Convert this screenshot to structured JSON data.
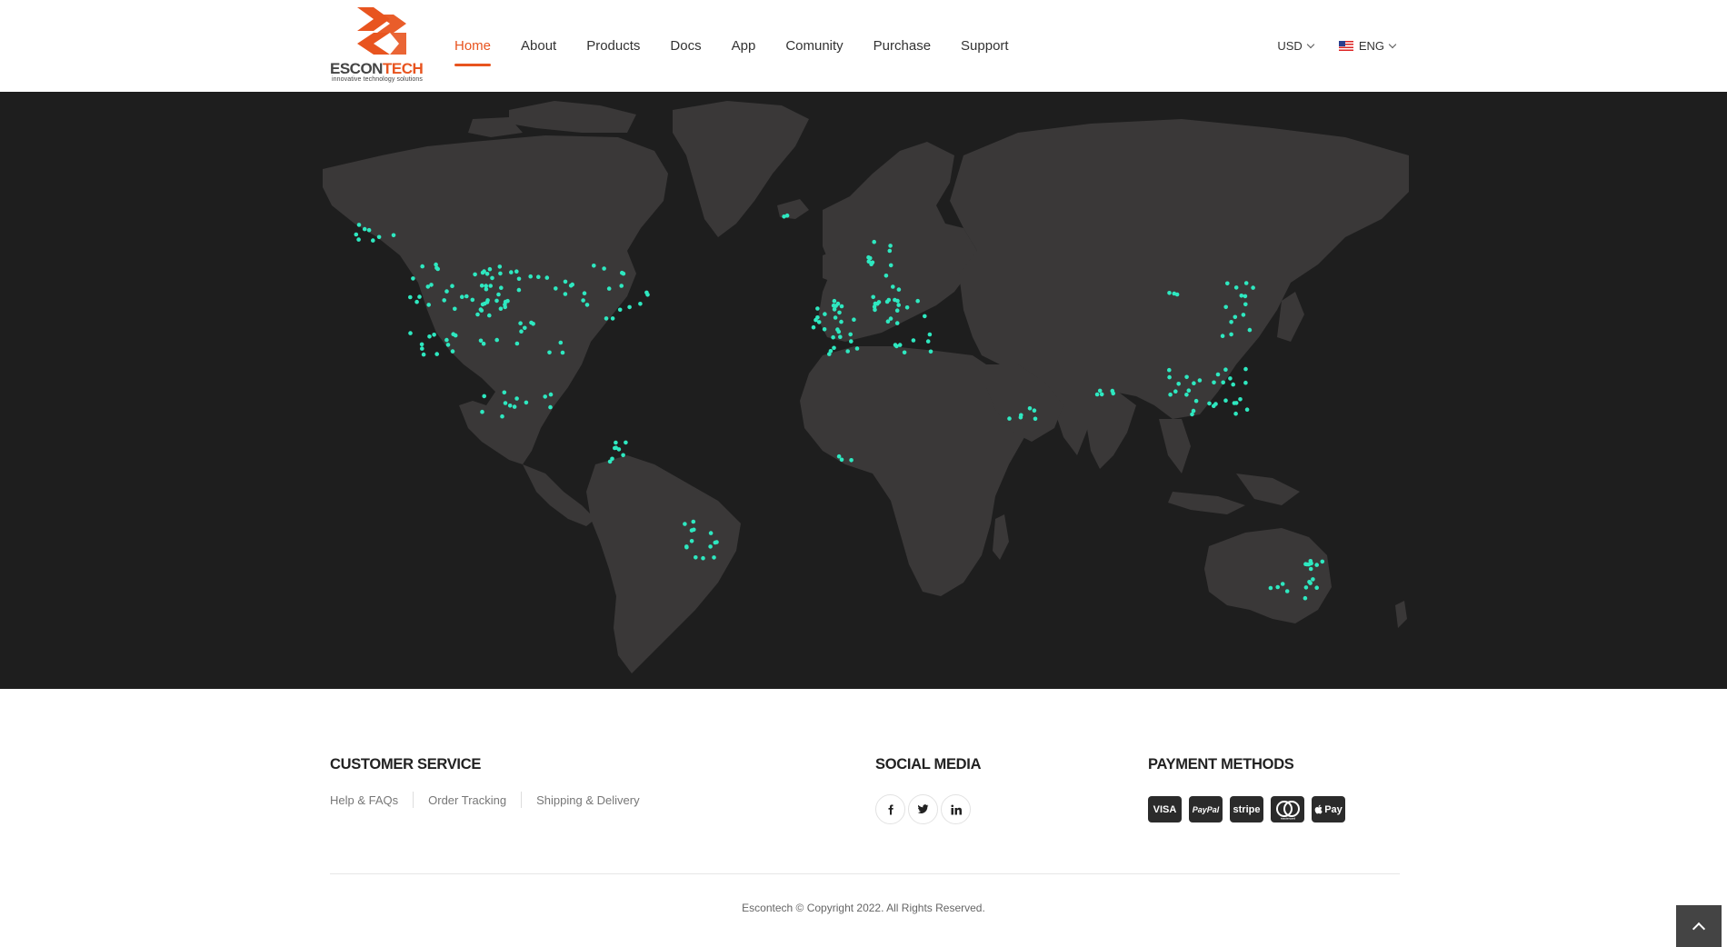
{
  "brand": {
    "name_part1": "ESCON",
    "name_part2": "TECH",
    "tagline": "innovative technology solutions",
    "accent_color": "#e8541f"
  },
  "nav": {
    "items": [
      {
        "label": "Home",
        "active": true
      },
      {
        "label": "About"
      },
      {
        "label": "Products"
      },
      {
        "label": "Docs"
      },
      {
        "label": "App"
      },
      {
        "label": "Comunity"
      },
      {
        "label": "Purchase"
      },
      {
        "label": "Support"
      }
    ]
  },
  "header_right": {
    "currency": "USD",
    "language": "ENG"
  },
  "map": {
    "background_color": "#1e1e1e",
    "land_color": "#3a3838",
    "dot_color": "#2ee8c0"
  },
  "footer": {
    "customer_service": {
      "title": "CUSTOMER SERVICE",
      "links": [
        "Help & FAQs",
        "Order Tracking",
        "Shipping & Delivery"
      ]
    },
    "social_media": {
      "title": "SOCIAL MEDIA",
      "icons": [
        "facebook-icon",
        "twitter-icon",
        "linkedin-icon"
      ]
    },
    "payment_methods": {
      "title": "PAYMENT METHODS",
      "labels": [
        "VISA",
        "PayPal",
        "stripe",
        "mastercard",
        "Pay"
      ]
    },
    "copyright": "Escontech © Copyright 2022. All Rights Reserved."
  }
}
